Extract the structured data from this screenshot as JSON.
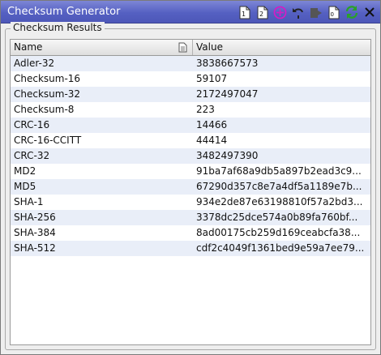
{
  "window": {
    "title": "Checksum Generator"
  },
  "toolbar": {
    "icons": [
      "file-1-icon",
      "file-2-icon",
      "add-icon",
      "undo-icon",
      "export-icon",
      "options-icon",
      "refresh-icon",
      "close-icon"
    ]
  },
  "group": {
    "label": "Checksum Results"
  },
  "table": {
    "columns": [
      "Name",
      "Value"
    ],
    "rows": [
      {
        "name": "Adler-32",
        "value": "3838667573"
      },
      {
        "name": "Checksum-16",
        "value": "59107"
      },
      {
        "name": "Checksum-32",
        "value": "2172497047"
      },
      {
        "name": "Checksum-8",
        "value": "223"
      },
      {
        "name": "CRC-16",
        "value": "14466"
      },
      {
        "name": "CRC-16-CCITT",
        "value": "44414"
      },
      {
        "name": "CRC-32",
        "value": "3482497390"
      },
      {
        "name": "MD2",
        "value": "91ba7af68a9db5a897b2ead3c9..."
      },
      {
        "name": "MD5",
        "value": "67290d357c8e7a4df5a1189e7b..."
      },
      {
        "name": "SHA-1",
        "value": "934e2de87e63198810f57a2bd3..."
      },
      {
        "name": "SHA-256",
        "value": "3378dc25dce574a0b89fa760bf..."
      },
      {
        "name": "SHA-384",
        "value": "8ad00175cb259d169ceabcfa38..."
      },
      {
        "name": "SHA-512",
        "value": "cdf2c4049f1361bed9e59a7ee79..."
      }
    ]
  },
  "colors": {
    "title_bar": "#5560c2",
    "alt_row": "#e9eef8",
    "add_icon": "#d21ec4",
    "refresh_icon": "#2aa12a"
  }
}
